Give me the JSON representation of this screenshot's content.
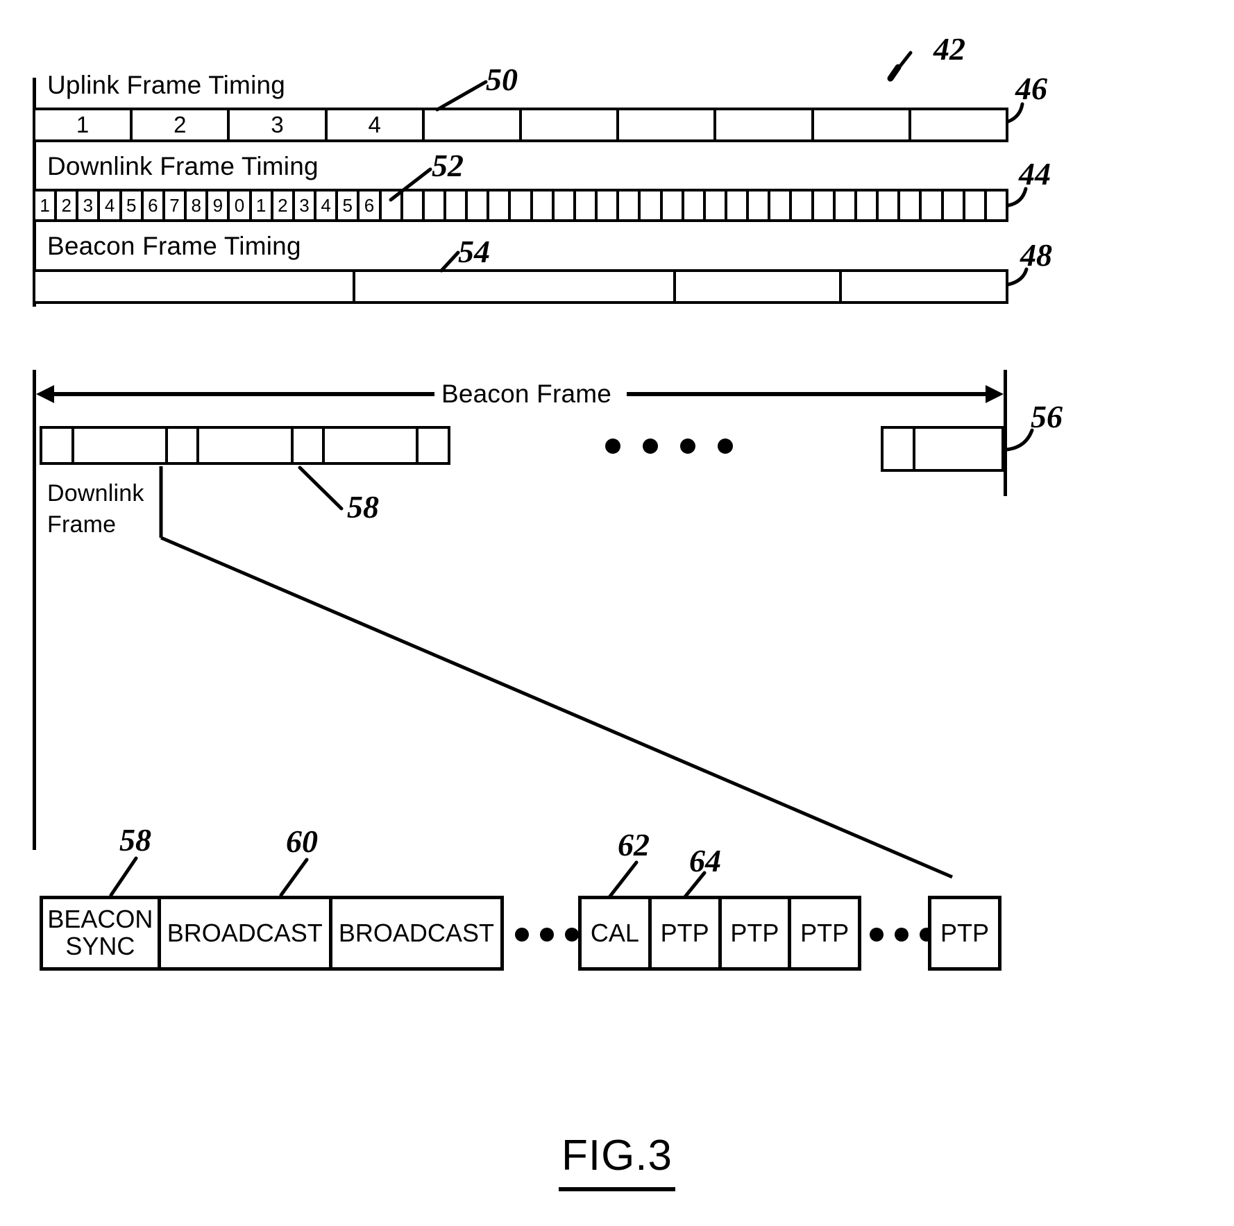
{
  "figure": {
    "caption": "FIG.3",
    "overall_ref": "42"
  },
  "timing_section": {
    "rows": [
      {
        "id": "uplink",
        "title": "Uplink Frame Timing",
        "ref_right": "46",
        "ref_tick": "50",
        "cells": [
          "1",
          "2",
          "3",
          "4",
          "",
          "",
          "",
          "",
          "",
          ""
        ]
      },
      {
        "id": "downlink",
        "title": "Downlink Frame Timing",
        "ref_right": "44",
        "ref_tick": "52",
        "cells": [
          "1",
          "2",
          "3",
          "4",
          "5",
          "6",
          "7",
          "8",
          "9",
          "0",
          "1",
          "2",
          "3",
          "4",
          "5",
          "6",
          "",
          "",
          "",
          "",
          "",
          "",
          "",
          "",
          "",
          "",
          "",
          "",
          "",
          "",
          "",
          "",
          "",
          "",
          "",
          "",
          "",
          "",
          "",
          "",
          "",
          "",
          "",
          "",
          ""
        ]
      },
      {
        "id": "beacon",
        "title": "Beacon Frame Timing",
        "ref_right": "48",
        "ref_tick": "54",
        "cells": [
          "",
          "",
          "",
          ""
        ]
      }
    ]
  },
  "beacon_frame_section": {
    "span_label": "Beacon Frame",
    "ref_right": "56",
    "downlink_label_line1": "Downlink",
    "downlink_label_line2": "Frame",
    "ref_downlink_frame": "58",
    "ellipsis_dot_count": 4,
    "left_cells_widths": [
      "narrow",
      "wide",
      "narrow",
      "wide",
      "narrow",
      "wide",
      "narrow"
    ],
    "right_cells_widths": [
      "narrow",
      "narrow"
    ]
  },
  "downlink_detail": {
    "boxes": [
      {
        "label": "BEACON SYNC",
        "line1": "BEACON",
        "line2": "SYNC",
        "ref": "58"
      },
      {
        "label": "BROADCAST",
        "line1": "BROADCAST",
        "line2": "",
        "ref": "60"
      },
      {
        "label": "BROADCAST",
        "line1": "BROADCAST",
        "line2": "",
        "ref": ""
      },
      {
        "label": "CAL",
        "line1": "CAL",
        "line2": "",
        "ref": "62"
      },
      {
        "label": "PTP",
        "line1": "PTP",
        "line2": "",
        "ref": "64"
      },
      {
        "label": "PTP",
        "line1": "PTP",
        "line2": "",
        "ref": ""
      },
      {
        "label": "PTP",
        "line1": "PTP",
        "line2": "",
        "ref": ""
      },
      {
        "label": "PTP",
        "line1": "PTP",
        "line2": "",
        "ref": ""
      }
    ],
    "ellipsis_groups": [
      3,
      3,
      3
    ]
  },
  "colors": {
    "ink": "#000000",
    "paper": "#ffffff"
  }
}
